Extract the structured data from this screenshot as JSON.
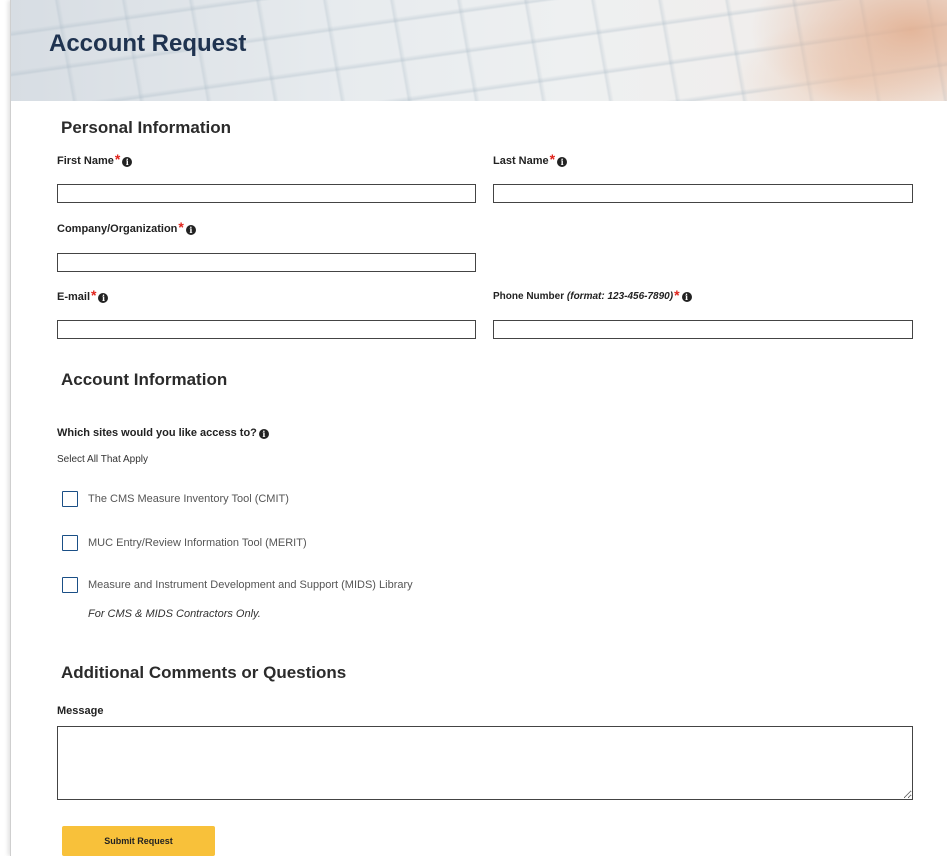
{
  "page": {
    "title": "Account Request"
  },
  "personal": {
    "heading": "Personal Information",
    "first_name": {
      "label": "First Name",
      "value": ""
    },
    "last_name": {
      "label": "Last Name",
      "value": ""
    },
    "company": {
      "label": "Company/Organization",
      "value": ""
    },
    "email": {
      "label": "E-mail",
      "value": ""
    },
    "phone": {
      "label": "Phone Number",
      "format_hint": "(format: 123-456-7890)",
      "value": ""
    }
  },
  "required_marker": "*",
  "info_glyph": "i",
  "account": {
    "heading": "Account Information",
    "question": "Which sites would you like access to?",
    "instruction": "Select All That Apply",
    "options": [
      {
        "label": "The CMS Measure Inventory Tool (CMIT)",
        "checked": false
      },
      {
        "label": "MUC Entry/Review Information Tool (MERIT)",
        "checked": false
      },
      {
        "label": "Measure and Instrument Development and Support (MIDS) Library",
        "checked": false
      }
    ],
    "mids_note": "For CMS & MIDS Contractors Only."
  },
  "comments": {
    "heading": "Additional Comments or Questions",
    "message_label": "Message",
    "message_value": ""
  },
  "actions": {
    "submit_label": "Submit Request"
  },
  "colors": {
    "title": "#1f3350",
    "required": "#e0231b",
    "checkbox_border": "#1a4f86",
    "submit_bg": "#f8c13a"
  }
}
